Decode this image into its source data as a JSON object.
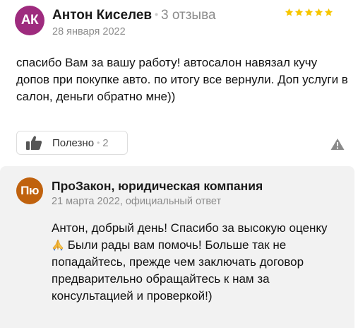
{
  "review": {
    "avatar_initials": "АК",
    "avatar_color": "#9e2b7e",
    "author": "Антон Киселев",
    "reviews_count": "3 отзыва",
    "date": "28 января 2022",
    "rating": 5,
    "star_color": "#f7c600",
    "text": "спасибо Вам за вашу работу! автосалон навязал кучу допов при покупке авто. по итогу все вернули. Доп услуги в салон, деньги обратно мне))",
    "helpful_label": "Полезно",
    "helpful_count": "2",
    "report_icon": "warning-icon"
  },
  "response": {
    "avatar_initials": "Пю",
    "avatar_color": "#c0620e",
    "company": "ПроЗакон, юридическая компания",
    "date_line": "21 марта 2022, официальный ответ",
    "text_before_emoji": "Антон, добрый день! Спасибо за высокую оценку",
    "emoji": "folded-hands-emoji",
    "text_after_emoji": "Были рады вам помочь! Больше так не попадайтесь, прежде чем заключать договор предварительно обращайтесь к нам за консультацией и проверкой!)"
  }
}
